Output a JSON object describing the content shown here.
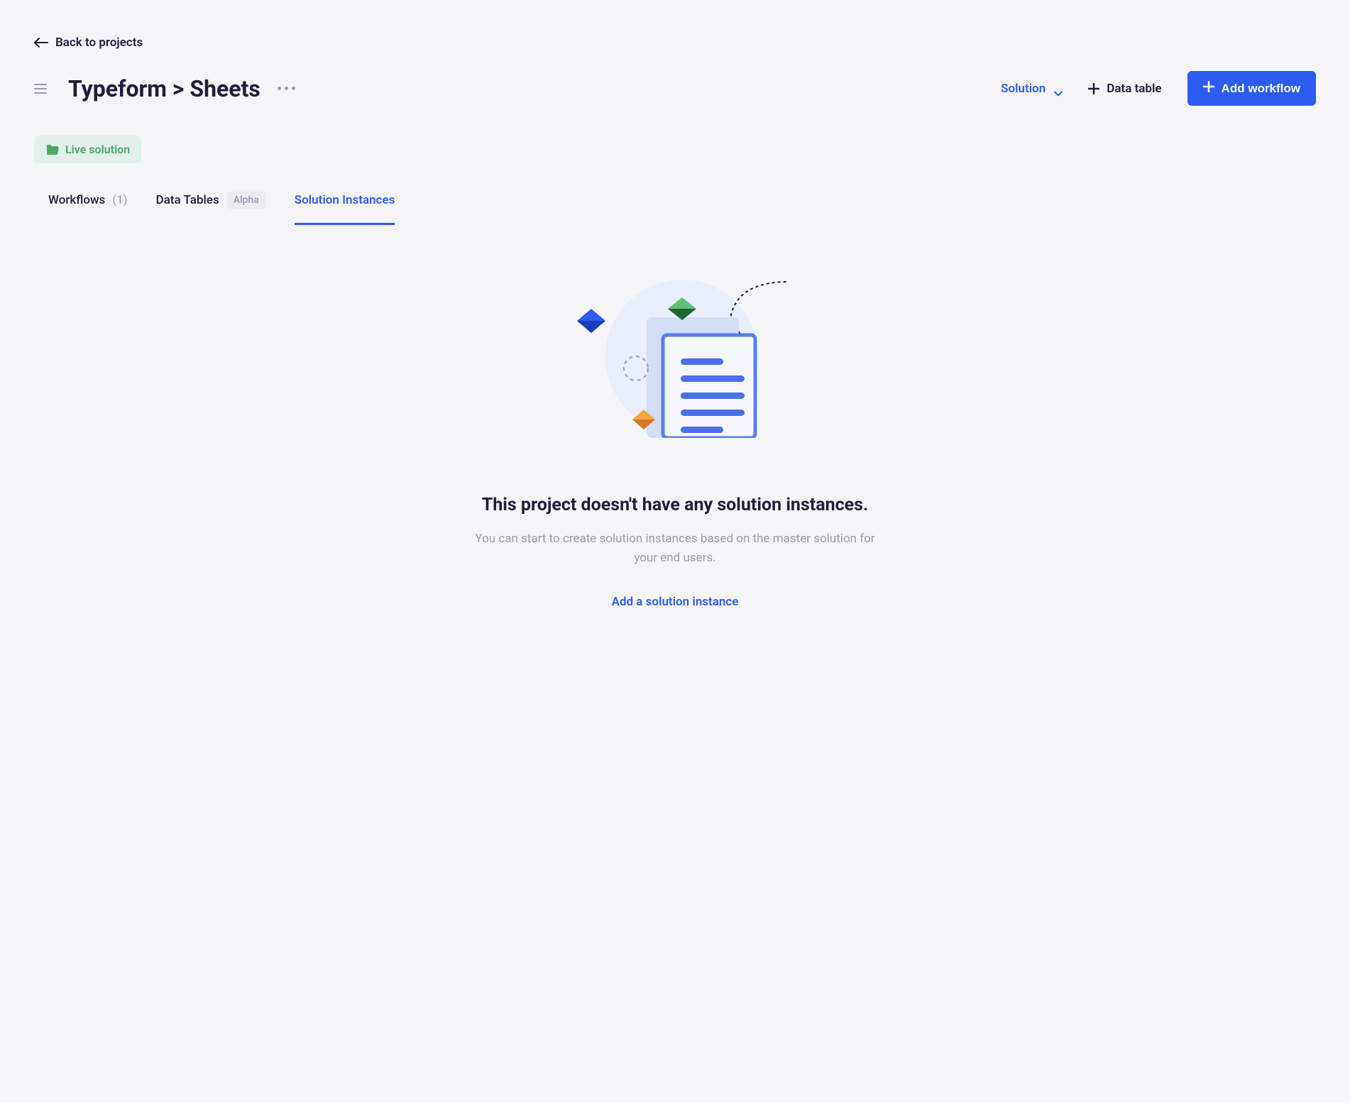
{
  "nav": {
    "back_label": "Back to projects"
  },
  "header": {
    "title": "Typeform > Sheets",
    "solution_menu_label": "Solution",
    "data_table_label": "Data table",
    "add_workflow_label": "Add workflow"
  },
  "status": {
    "label": "Live solution"
  },
  "tabs": [
    {
      "label": "Workflows",
      "count": "(1)",
      "active": false
    },
    {
      "label": "Data Tables",
      "badge": "Alpha",
      "active": false
    },
    {
      "label": "Solution Instances",
      "active": true
    }
  ],
  "empty_state": {
    "title": "This project doesn't have any solution instances.",
    "description": "You can start to create solution instances based on the master solution for your end users.",
    "action_label": "Add a solution instance"
  }
}
